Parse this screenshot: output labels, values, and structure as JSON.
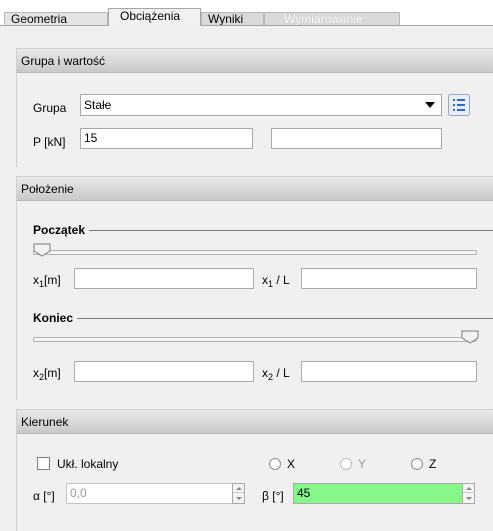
{
  "tabs": [
    {
      "label": "Geometria"
    },
    {
      "label": "Obciążenia"
    },
    {
      "label": "Wyniki"
    },
    {
      "label": "Wymiarowanie"
    }
  ],
  "group_value": {
    "header": "Grupa i wartość",
    "group_label": "Grupa",
    "group_value": "Stałe",
    "p_label": "P [kN]",
    "p_value": "15",
    "p_value2": ""
  },
  "position": {
    "header": "Położenie",
    "start_title": "Początek",
    "start_slider_level": 0,
    "x1_label_a": "x",
    "x1_sub": "1",
    "x1_label_b": "[m]",
    "x1_value": "",
    "x1L_label_a": "x",
    "x1L_sub": "1",
    "x1L_label_b": " / L",
    "x1L_value": "",
    "end_title": "Koniec",
    "end_slider_level": 1,
    "x2_label_a": "x",
    "x2_sub": "2",
    "x2_label_b": "[m]",
    "x2_value": "",
    "x2L_label_a": "x",
    "x2L_sub": "2",
    "x2L_label_b": " / L",
    "x2L_value": ""
  },
  "direction": {
    "header": "Kierunek",
    "local_label": "Ukł. lokalny",
    "radio_x": "X",
    "radio_y": "Y",
    "radio_z": "Z",
    "alpha_label": "α [°]",
    "alpha_value": "0,0",
    "beta_label": "β [°]",
    "beta_value": "45"
  },
  "colors": {
    "active_input": "#88f78a"
  }
}
